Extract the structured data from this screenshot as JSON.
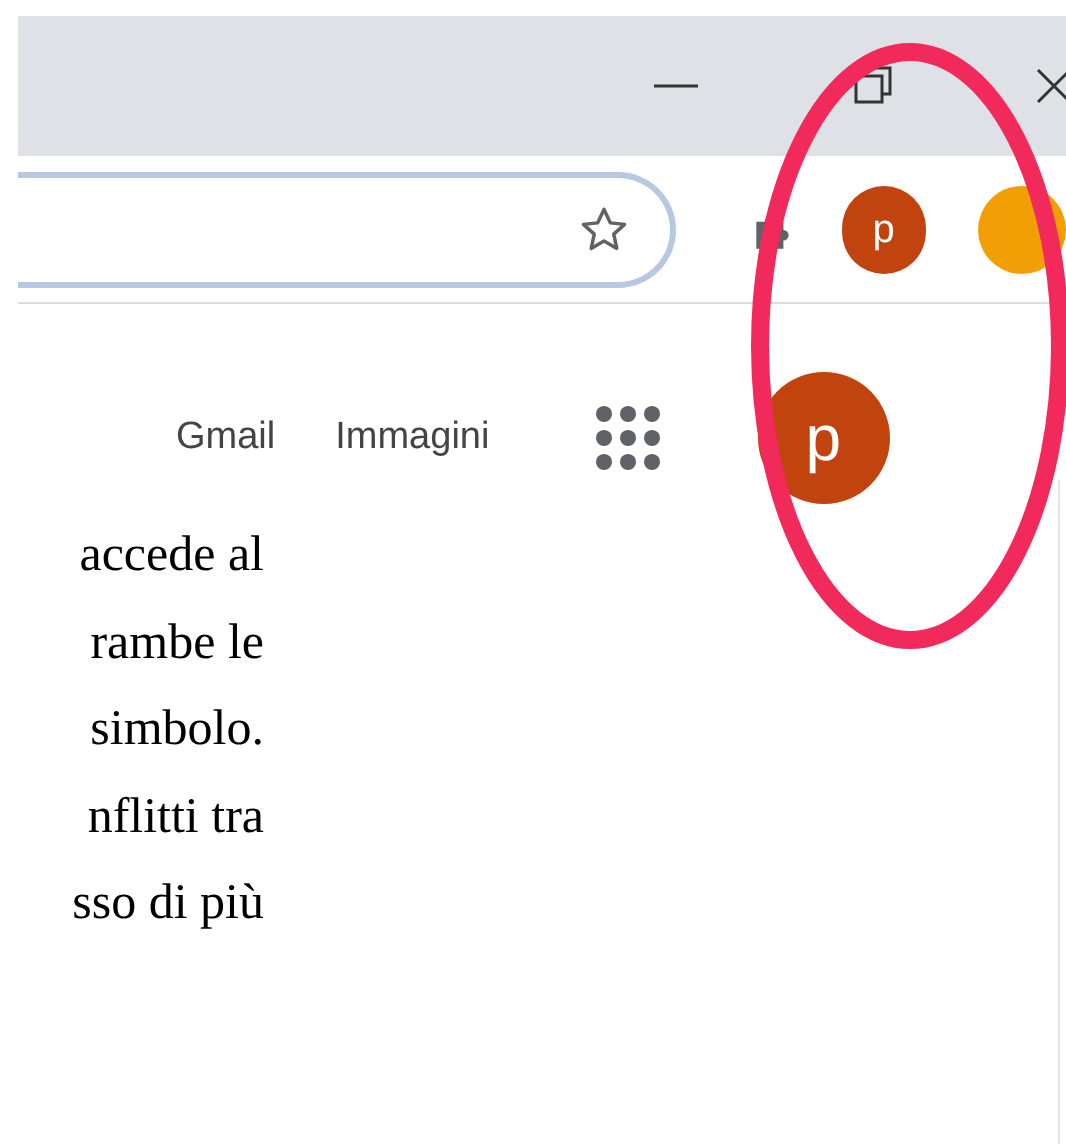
{
  "toolbar": {
    "profile_avatar": "p"
  },
  "page_header": {
    "links": [
      "Gmail",
      "Immagini"
    ],
    "account_avatar": "p"
  },
  "document_text": {
    "lines": [
      "accede al",
      "rambe le",
      "simbolo.",
      "nflitti tra",
      "sso di più"
    ]
  }
}
